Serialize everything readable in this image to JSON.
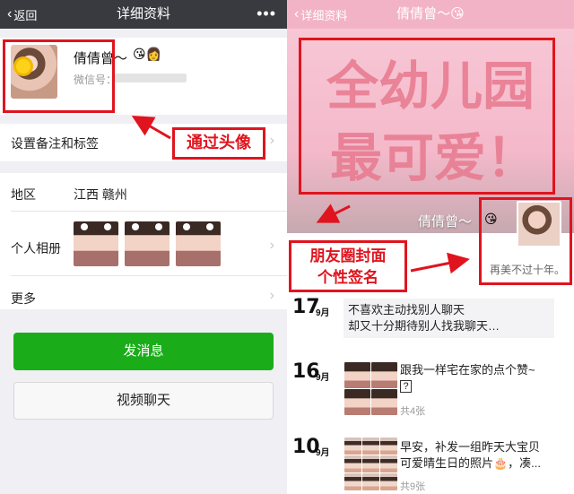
{
  "left": {
    "nav": {
      "back_label": "返回",
      "title": "详细资料",
      "more": "•••"
    },
    "profile": {
      "name": "倩倩曾～",
      "name_emoji": "😘👩",
      "wechat_label": "微信号："
    },
    "rows": {
      "remark": "设置备注和标签",
      "region_label": "地区",
      "region_value": "江西 赣州",
      "album_label": "个人相册",
      "more_label": "更多"
    },
    "buttons": {
      "message": "发消息",
      "video": "视频聊天"
    },
    "callout": "通过头像"
  },
  "right": {
    "nav": {
      "back_label": "详细资料",
      "title": "倩倩曾～😘"
    },
    "cover_text": [
      "全幼儿园",
      "最可爱！"
    ],
    "cover_name": "倩倩曾～",
    "cover_emoji": "😘",
    "signature": "再美不过十年。",
    "callout_line1": "朋友圈封面",
    "callout_line2": "个性签名",
    "feed": [
      {
        "day": "17",
        "month": "9月",
        "line1": "不喜欢主动找别人聊天",
        "line2": "却又十分期待别人找我聊天…"
      },
      {
        "day": "16",
        "month": "9月",
        "line1": "跟我一样宅在家的点个赞~",
        "line2": "?",
        "count": "共4张"
      },
      {
        "day": "10",
        "month": "9月",
        "line1": "早安，补发一组昨天大宝贝",
        "line2": "可爱晴生日的照片🎂，凑...",
        "count": "共9张"
      }
    ]
  },
  "colors": {
    "wechat_green": "#1aad19",
    "highlight_red": "#e0141e",
    "nav_dark": "#393a3f",
    "cover_pink": "#f4b9ca"
  }
}
